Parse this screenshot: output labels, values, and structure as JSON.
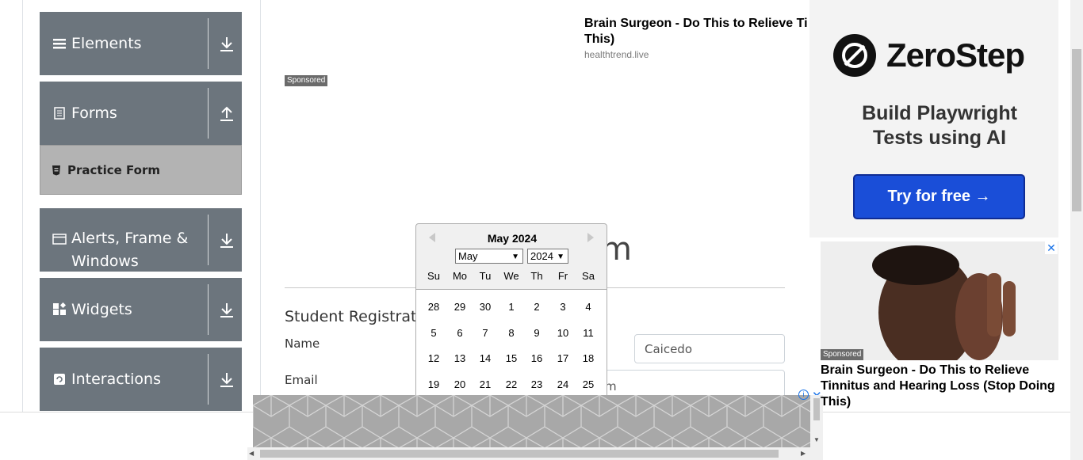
{
  "sidebar": {
    "groups": [
      {
        "label": "Elements",
        "icon": "menu-icon",
        "expanded": false
      },
      {
        "label": "Forms",
        "icon": "document-icon",
        "expanded": true
      },
      {
        "label": "Alerts, Frame &",
        "label2": "Windows",
        "icon": "window-icon",
        "expanded": false
      },
      {
        "label": "Widgets",
        "icon": "widgets-icon",
        "expanded": false
      },
      {
        "label": "Interactions",
        "icon": "interactions-icon",
        "expanded": false
      }
    ],
    "active_item": "Practice Form"
  },
  "top_ad": {
    "title_line1": "Brain Surgeon - Do This to Relieve Ti",
    "title_line2": "This)",
    "source": "healthtrend.live",
    "sponsored": "Sponsored"
  },
  "main": {
    "heading_fragment": "m",
    "form_title": "Student Registratio",
    "name_label": "Name",
    "last_name_value": "Caicedo",
    "email_label": "Email",
    "email_fragment": "m"
  },
  "datepicker": {
    "title": "May 2024",
    "month_select": "May",
    "year_select": "2024",
    "weekdays": [
      "Su",
      "Mo",
      "Tu",
      "We",
      "Th",
      "Fr",
      "Sa"
    ],
    "weeks": [
      [
        "28",
        "29",
        "30",
        "1",
        "2",
        "3",
        "4"
      ],
      [
        "5",
        "6",
        "7",
        "8",
        "9",
        "10",
        "11"
      ],
      [
        "12",
        "13",
        "14",
        "15",
        "16",
        "17",
        "18"
      ],
      [
        "19",
        "20",
        "21",
        "22",
        "23",
        "24",
        "25"
      ]
    ]
  },
  "right_ad": {
    "brand": "ZeroStep",
    "tagline_line1": "Build Playwright",
    "tagline_line2": "Tests using AI",
    "button": "Try for free →"
  },
  "right_ad2": {
    "sponsored": "Sponsored",
    "title": "Brain Surgeon - Do This to Relieve Tinnitus and Hearing Loss (Stop Doing This)"
  },
  "colors": {
    "sidebar_bg": "#6c757d",
    "active_item_bg": "#b3b3b3",
    "cta_blue": "#1a4ed8"
  }
}
